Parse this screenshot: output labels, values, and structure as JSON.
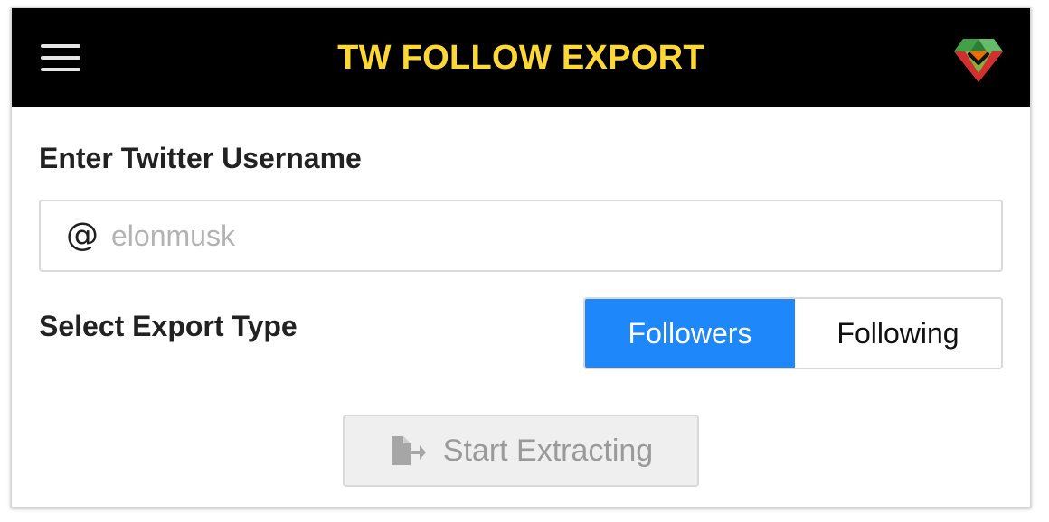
{
  "header": {
    "title": "TW FOLLOW EXPORT",
    "menu_icon": "hamburger-menu-icon",
    "logo_icon": "gem-logo-icon",
    "background_color": "#000000",
    "title_color": "#fdd835"
  },
  "username_section": {
    "label": "Enter Twitter Username",
    "prefix": "@",
    "input_value": "",
    "placeholder": "elonmusk"
  },
  "export_section": {
    "label": "Select Export Type",
    "options": [
      "Followers",
      "Following"
    ],
    "selected": "Followers",
    "active_color": "#1e87fa"
  },
  "action": {
    "start_label": "Start Extracting",
    "icon": "file-export-icon",
    "enabled": false
  }
}
